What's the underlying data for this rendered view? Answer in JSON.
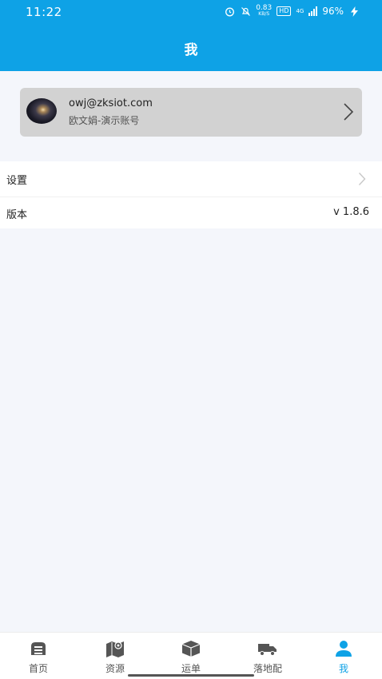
{
  "status_bar": {
    "time": "11:22",
    "speed_value": "0.83",
    "speed_unit": "KB/S",
    "hd": "HD",
    "network": "4G",
    "battery": "96%",
    "icons": [
      "alarm-icon",
      "mute-icon",
      "signal-icon",
      "charging-icon"
    ]
  },
  "header": {
    "title": "我"
  },
  "profile": {
    "email": "owj@zksiot.com",
    "account_name": "欧文娟-演示账号"
  },
  "settings_list": {
    "settings_label": "设置",
    "version_label": "版本",
    "version_value": "v 1.8.6"
  },
  "tabbar": {
    "tabs": [
      {
        "label": "首页",
        "icon": "home-icon"
      },
      {
        "label": "资源",
        "icon": "map-icon"
      },
      {
        "label": "运单",
        "icon": "box-icon"
      },
      {
        "label": "落地配",
        "icon": "truck-icon"
      },
      {
        "label": "我",
        "icon": "user-icon"
      }
    ],
    "active_index": 4
  },
  "colors": {
    "accent": "#0ea2e6",
    "tab_inactive": "#555555",
    "card_bg": "#d2d2d2",
    "page_bg": "#f4f6fb"
  }
}
